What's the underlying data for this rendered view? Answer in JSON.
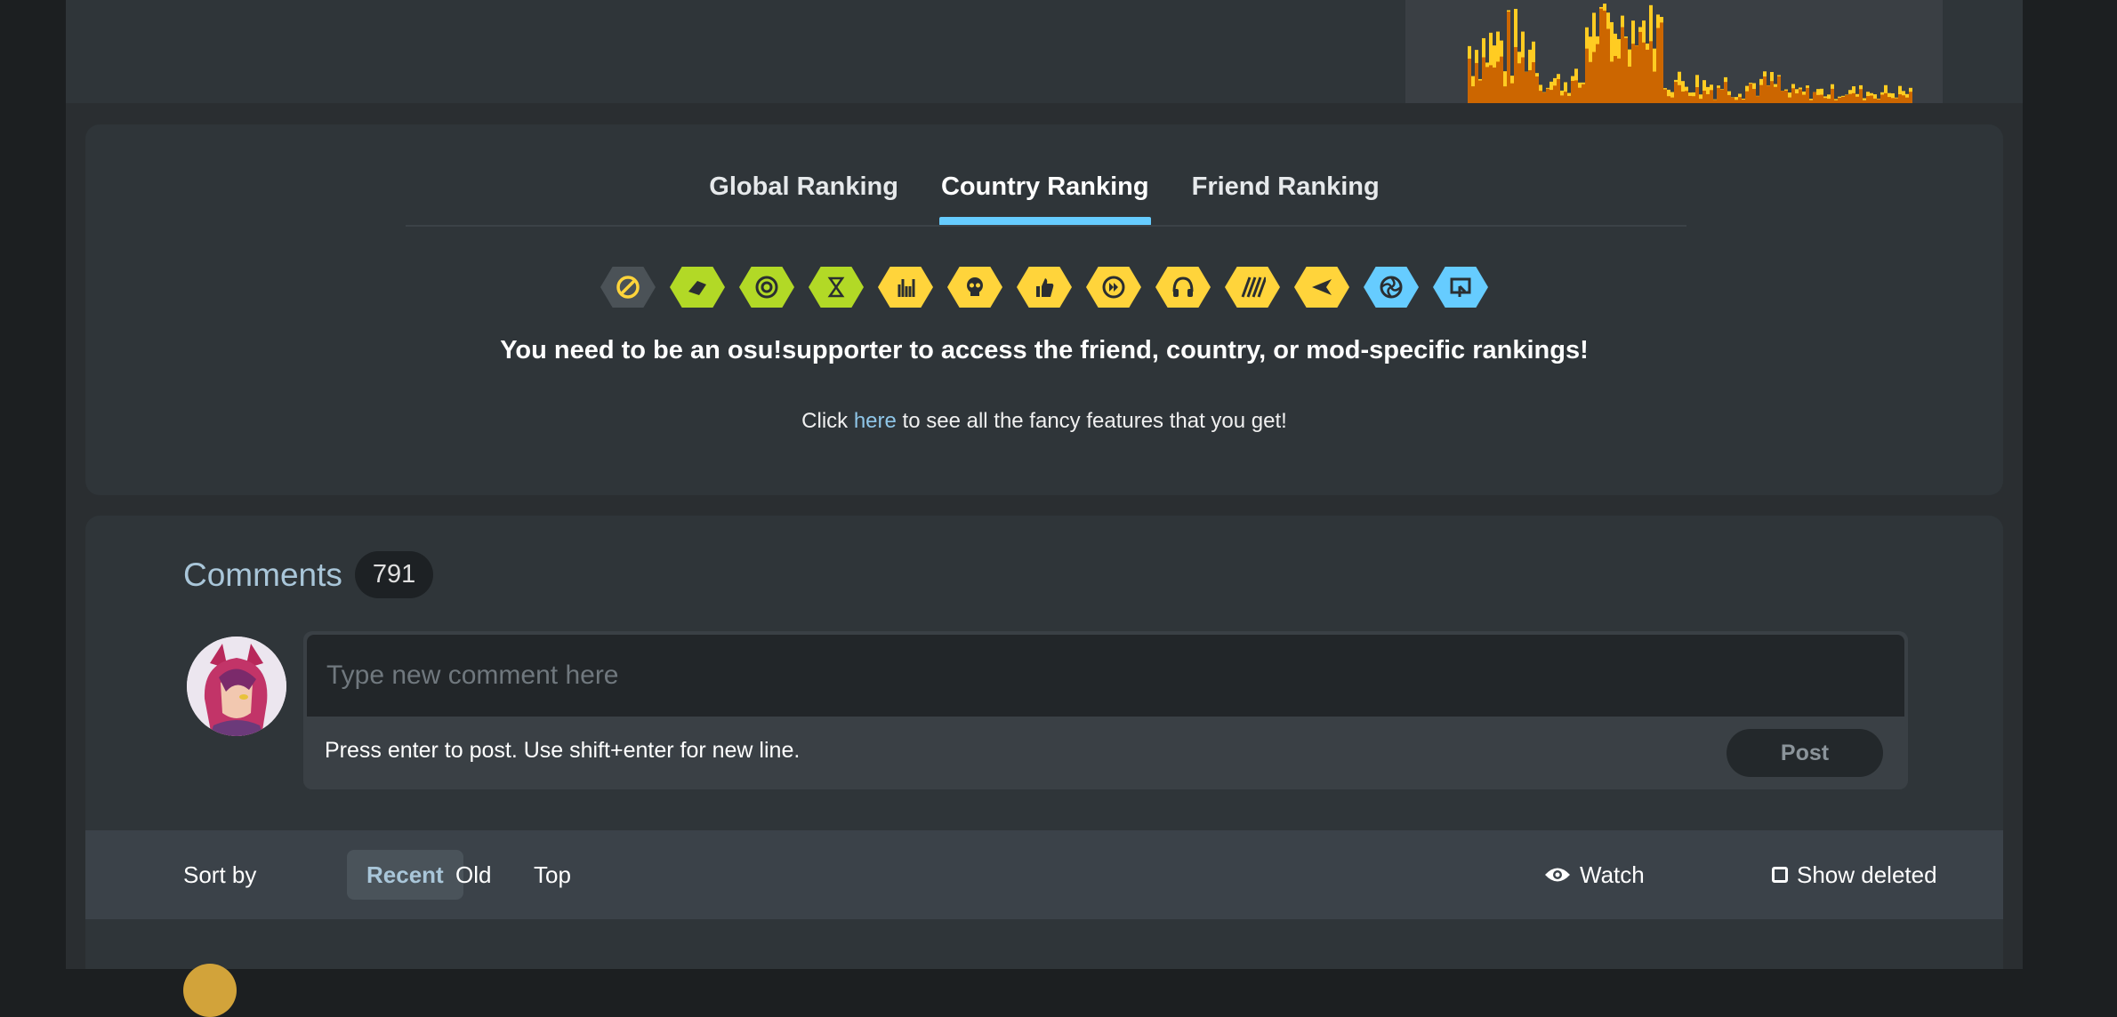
{
  "ranking": {
    "tabs": [
      {
        "label": "Global Ranking",
        "active": false
      },
      {
        "label": "Country Ranking",
        "active": true
      },
      {
        "label": "Friend Ranking",
        "active": false
      }
    ],
    "mods": [
      {
        "icon": "no-mod-icon",
        "color": "gray"
      },
      {
        "icon": "easy-icon",
        "color": "green"
      },
      {
        "icon": "no-fail-icon",
        "color": "green"
      },
      {
        "icon": "half-time-icon",
        "color": "green"
      },
      {
        "icon": "hard-rock-icon",
        "color": "yellow"
      },
      {
        "icon": "sudden-death-icon",
        "color": "yellow"
      },
      {
        "icon": "perfect-icon",
        "color": "yellow"
      },
      {
        "icon": "double-time-icon",
        "color": "yellow"
      },
      {
        "icon": "hidden-icon",
        "color": "yellow"
      },
      {
        "icon": "flashlight-icon",
        "color": "yellow"
      },
      {
        "icon": "spun-out-icon",
        "color": "yellow"
      },
      {
        "icon": "relax-icon",
        "color": "blue"
      },
      {
        "icon": "touch-device-icon",
        "color": "blue"
      }
    ],
    "notice": "You need to be an osu!supporter to access the friend, country, or mod-specific rankings!",
    "click_prefix": "Click",
    "click_link": "here",
    "click_suffix": "to see all the fancy features that you get!"
  },
  "comments": {
    "title": "Comments",
    "count": "791",
    "editor": {
      "placeholder": "Type new comment here",
      "hint": "Press enter to post. Use shift+enter for new line.",
      "post_label": "Post"
    },
    "sort": {
      "label": "Sort by",
      "options": [
        "Recent",
        "Old",
        "Top"
      ],
      "active": "Recent",
      "watch_label": "Watch",
      "show_deleted_label": "Show deleted"
    }
  },
  "colors": {
    "accent": "#66ccff",
    "mod_green": "#b2d926",
    "mod_yellow": "#ffd43b",
    "graph_orange": "#cc6600",
    "graph_yellow": "#ffcc22"
  }
}
